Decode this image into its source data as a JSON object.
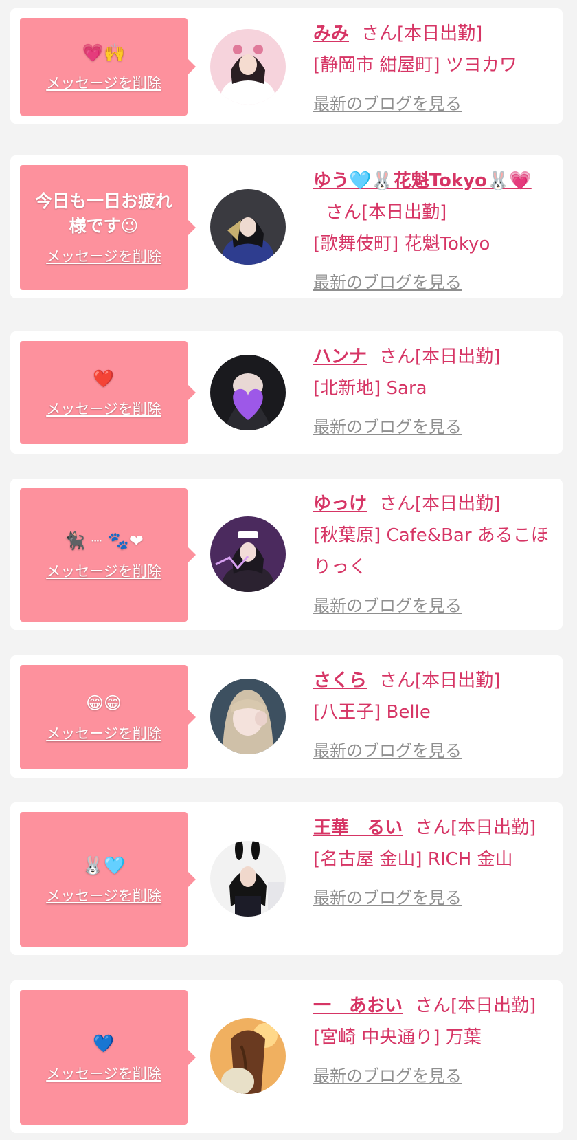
{
  "common": {
    "delete_label": "メッセージを削除",
    "blog_label": "最新のブログを見る",
    "san_suffix": "さん",
    "status": "[本日出勤]"
  },
  "colors": {
    "bubble": "#fd919d",
    "name": "#d63565",
    "blog_link": "#8f8f8f",
    "page_bg": "#f3f3f3"
  },
  "cards": [
    {
      "message": "💗🙌",
      "name": "みみ",
      "shop": "[静岡市 紺屋町] ツヨカワ",
      "avatar": "avatar-pink-dress"
    },
    {
      "message": "今日も一日お疲れ様です😉",
      "name": "ゆう🩵🐰花魁Tokyo🐰💗",
      "shop": "[歌舞伎町] 花魁Tokyo",
      "avatar": "avatar-kimono"
    },
    {
      "message": "❤️",
      "name": "ハンナ",
      "shop": "[北新地] Sara",
      "avatar": "avatar-purple-heart"
    },
    {
      "message": "🐈‍⬛ ┈ 🐾❤",
      "name": "ゆっけ",
      "shop": "[秋葉原] Cafe&Bar あるこほりっく",
      "avatar": "avatar-nurse"
    },
    {
      "message": "😁😁",
      "name": "さくら",
      "shop": "[八王子] Belle",
      "avatar": "avatar-blonde"
    },
    {
      "message": "🐰🩵",
      "name": "王華　るい",
      "shop": "[名古屋 金山] RICH 金山",
      "avatar": "avatar-bunny"
    },
    {
      "message": "💙",
      "name": "一　あおい",
      "shop": "[宮崎 中央通り] 万葉",
      "avatar": "avatar-hair-back"
    }
  ]
}
